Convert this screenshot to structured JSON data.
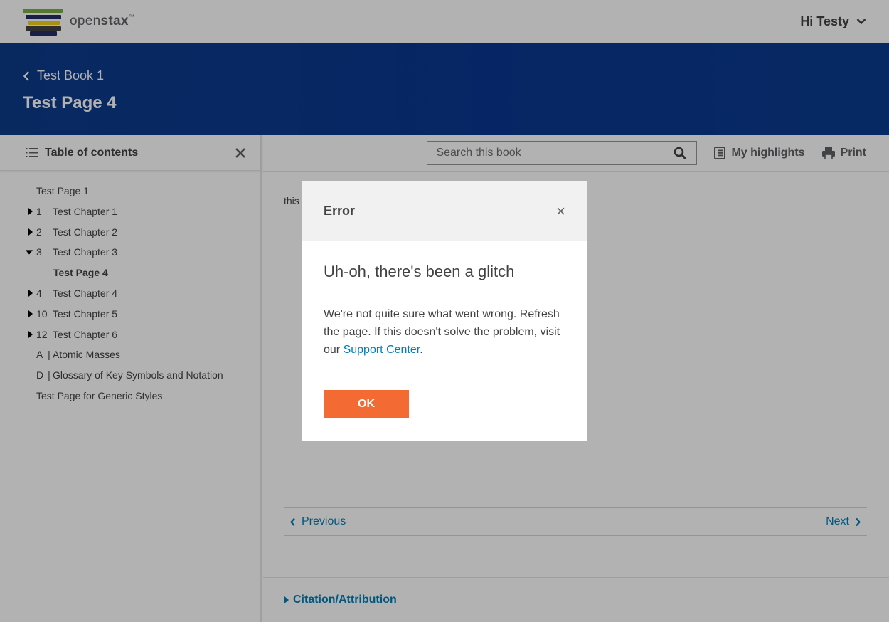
{
  "header": {
    "logo_text_light": "open",
    "logo_text_bold": "stax",
    "logo_tm": "™",
    "user_greeting": "Hi Testy"
  },
  "hero": {
    "breadcrumb": "Test Book 1",
    "page_title": "Test Page 4"
  },
  "sidebar": {
    "title": "Table of contents",
    "items": [
      {
        "num": "",
        "label": "Test Page 1",
        "caret": ""
      },
      {
        "num": "1",
        "label": "Test Chapter 1",
        "caret": "right"
      },
      {
        "num": "2",
        "label": "Test Chapter 2",
        "caret": "right"
      },
      {
        "num": "3",
        "label": "Test Chapter 3",
        "caret": "down"
      },
      {
        "num": "",
        "label": "Test Page 4",
        "caret": "",
        "sub": true
      },
      {
        "num": "4",
        "label": "Test Chapter 4",
        "caret": "right"
      },
      {
        "num": "10",
        "label": "Test Chapter 5",
        "caret": "right"
      },
      {
        "num": "12",
        "label": "Test Chapter 6",
        "caret": "right"
      },
      {
        "num": "A",
        "sep": "|",
        "label": "Atomic Masses",
        "caret": ""
      },
      {
        "num": "D",
        "sep": "|",
        "label": "Glossary of Key Symbols and Notation",
        "caret": ""
      },
      {
        "num": "",
        "label": "Test Page for Generic Styles",
        "caret": ""
      }
    ]
  },
  "toolbar": {
    "search_placeholder": "Search this book",
    "highlights_label": "My highlights",
    "print_label": "Print"
  },
  "content": {
    "body_text": "this",
    "prev_label": "Previous",
    "next_label": "Next",
    "citation_label": "Citation/Attribution"
  },
  "modal": {
    "title": "Error",
    "close": "×",
    "heading": "Uh-oh, there's been a glitch",
    "text_before": "We're not quite sure what went wrong. Refresh the page. If this doesn't solve the problem, visit our ",
    "link_label": "Support Center",
    "text_after": ".",
    "ok_label": "OK"
  },
  "colors": {
    "accent_orange": "#f36b32",
    "link_blue": "#027eb5",
    "hero_blue": "#0c3b8a"
  }
}
